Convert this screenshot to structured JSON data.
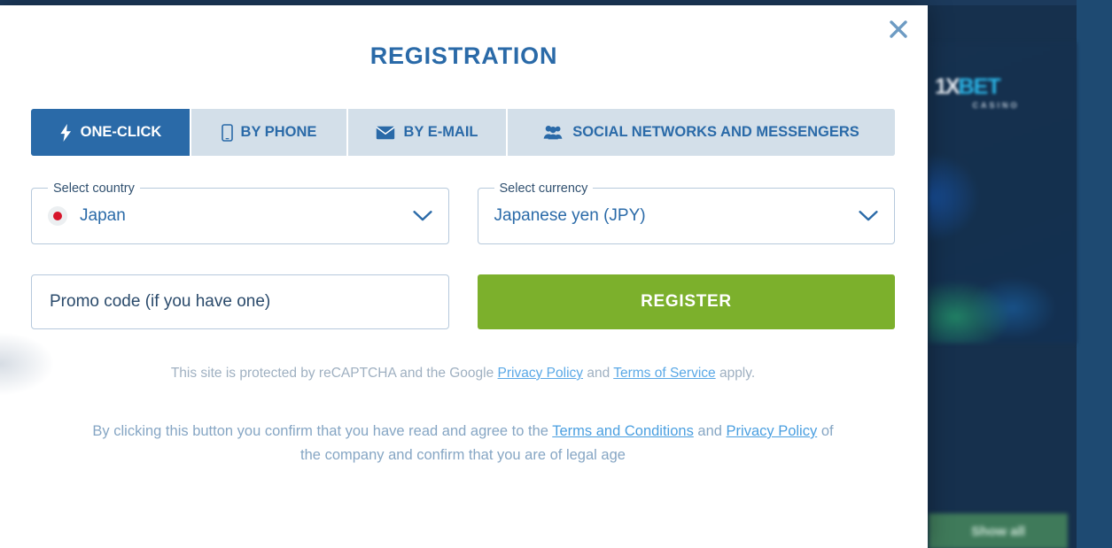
{
  "background": {
    "logo_1x": "1X",
    "logo_bet": "BET",
    "logo_sub": "CASINO",
    "show_all_label": "Show all"
  },
  "modal": {
    "title": "REGISTRATION",
    "close_icon": "close-icon",
    "tabs": [
      {
        "id": "one-click",
        "label": "ONE-CLICK",
        "icon": "bolt-icon",
        "active": true
      },
      {
        "id": "by-phone",
        "label": "BY PHONE",
        "icon": "mobile-phone-icon",
        "active": false
      },
      {
        "id": "by-email",
        "label": "BY E-MAIL",
        "icon": "envelope-icon",
        "active": false
      },
      {
        "id": "social",
        "label": "SOCIAL NETWORKS AND MESSENGERS",
        "icon": "users-group-icon",
        "active": false
      }
    ],
    "country_select": {
      "legend": "Select country",
      "value": "Japan",
      "flag": "japan-flag-icon",
      "chevron": "chevron-down-icon"
    },
    "currency_select": {
      "legend": "Select currency",
      "value": "Japanese yen (JPY)",
      "chevron": "chevron-down-icon"
    },
    "promo": {
      "placeholder": "Promo code (if you have one)",
      "value": ""
    },
    "register_button": {
      "label": "REGISTER"
    },
    "recaptcha_note": {
      "part1": "This site is protected by reCAPTCHA and the Google ",
      "link1": "Privacy Policy",
      "part2": " and ",
      "link2": "Terms of Service",
      "part3": " apply."
    },
    "terms_note": {
      "part1": "By clicking this button you confirm that you have read and agree to the ",
      "link1": "Terms and Conditions",
      "part2": " and ",
      "link2": "Privacy Policy",
      "part3": " of the company and confirm that you are of legal age"
    }
  },
  "colors": {
    "accent_blue": "#2a6aa8",
    "tab_inactive_bg": "#d3dfe9",
    "register_green": "#7cb02c",
    "link_blue": "#4a9fe0",
    "page_navy": "#16304d"
  }
}
